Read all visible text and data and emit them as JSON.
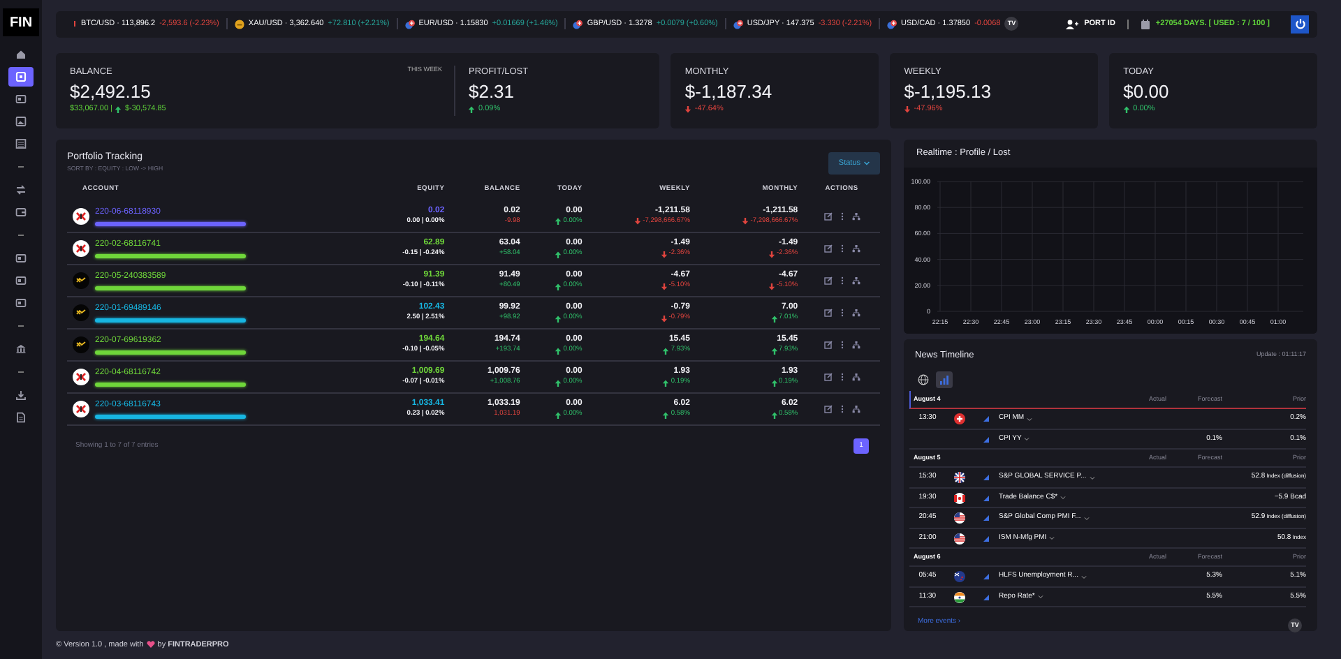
{
  "brand": {
    "logo": "FIN"
  },
  "sidebar": {
    "groups": [
      {
        "items": [
          {
            "kind": "home",
            "selected": false
          },
          {
            "kind": "square",
            "selected": true
          },
          {
            "kind": "card",
            "selected": false
          },
          {
            "kind": "image",
            "selected": false
          },
          {
            "kind": "list",
            "selected": false
          }
        ]
      },
      {
        "items": [
          {
            "kind": "exchange",
            "selected": false
          },
          {
            "kind": "wallet",
            "selected": false
          }
        ]
      },
      {
        "items": [
          {
            "kind": "card",
            "selected": false
          },
          {
            "kind": "card",
            "selected": false
          },
          {
            "kind": "card",
            "selected": false
          }
        ]
      },
      {
        "items": [
          {
            "kind": "bank",
            "selected": false
          }
        ]
      },
      {
        "items": [
          {
            "kind": "download",
            "selected": false
          },
          {
            "kind": "file",
            "selected": false
          }
        ]
      }
    ]
  },
  "ticker": {
    "items": [
      {
        "kind": "cut",
        "label": "BTC/USD · 113,896.2",
        "change": "-2,593.6 (-2.23%)",
        "rising": false
      },
      {
        "kind": "gold",
        "label": "XAU/USD · 3,362.640",
        "change": "+72.810 (+2.21%)",
        "rising": true
      },
      {
        "kind": "flags",
        "label": "EUR/USD · 1.15830",
        "change": "+0.01669 (+1.46%)",
        "rising": true
      },
      {
        "kind": "flags",
        "label": "GBP/USD · 1.3278",
        "change": "+0.0079 (+0.60%)",
        "rising": true
      },
      {
        "kind": "flags",
        "label": "USD/JPY · 147.375",
        "change": "-3.330 (-2.21%)",
        "rising": false
      },
      {
        "kind": "flags",
        "label": "USD/CAD · 1.37850",
        "change": "-0.0068",
        "rising": false
      }
    ],
    "badge": "TV"
  },
  "account": {
    "port_id": "PORT ID",
    "subscription": "+27054 DAYS. [ USED : 7 / 100 ]"
  },
  "balance_card": {
    "sections": [
      {
        "label": "BALANCE",
        "period": "THIS WEEK",
        "value": "$2,492.15",
        "base": "$33,067.00 |",
        "change": "$-30,574.85",
        "rising": true
      },
      {
        "label": "PROFIT/LOST",
        "value": "$2.31",
        "change": "0.09%",
        "rising": true
      }
    ]
  },
  "stat_cards": [
    {
      "label": "MONTHLY",
      "value": "$-1,187.34",
      "change": "-47.64%",
      "rising": false
    },
    {
      "label": "WEEKLY",
      "value": "$-1,195.13",
      "change": "-47.96%",
      "rising": false
    },
    {
      "label": "TODAY",
      "value": "$0.00",
      "change": "0.00%",
      "rising": true
    }
  ],
  "portfolio": {
    "title": "Portfolio Tracking",
    "subtitle": "SORT BY : EQUITY : LOW -> HIGH",
    "status_button": "Status",
    "columns": [
      "ACCOUNT",
      "EQUITY",
      "BALANCE",
      "TODAY",
      "WEEKLY",
      "MONTHLY",
      "ACTIONS"
    ],
    "rows": [
      {
        "kind": "xm",
        "account": "220-06-68118930",
        "color": "#6c63ff",
        "equity": "0.02",
        "equity_change": "0.00 | 0.00%",
        "balance": "0.02",
        "balance_change": "-9.98",
        "balance_up": false,
        "today": "0.00",
        "today_change": "0.00%",
        "today_up": true,
        "weekly": "-1,211.58",
        "weekly_change": "-7,298,666.67%",
        "weekly_up": false,
        "monthly": "-1,211.58",
        "monthly_change": "-7,298,666.67%",
        "monthly_up": false
      },
      {
        "kind": "xm",
        "account": "220-02-68116741",
        "color": "#6fd63a",
        "equity": "62.89",
        "equity_change": "-0.15 | -0.24%",
        "balance": "63.04",
        "balance_change": "+58.04",
        "balance_up": true,
        "today": "0.00",
        "today_change": "0.00%",
        "today_up": true,
        "weekly": "-1.49",
        "weekly_change": "-2.36%",
        "weekly_up": false,
        "monthly": "-1.49",
        "monthly_change": "-2.36%",
        "monthly_up": false
      },
      {
        "kind": "exness",
        "account": "220-05-240383589",
        "color": "#6fd63a",
        "equity": "91.39",
        "equity_change": "-0.10 | -0.11%",
        "balance": "91.49",
        "balance_change": "+80.49",
        "balance_up": true,
        "today": "0.00",
        "today_change": "0.00%",
        "today_up": true,
        "weekly": "-4.67",
        "weekly_change": "-5.10%",
        "weekly_up": false,
        "monthly": "-4.67",
        "monthly_change": "-5.10%",
        "monthly_up": false
      },
      {
        "kind": "exness",
        "account": "220-01-69489146",
        "color": "#17b6e2",
        "equity": "102.43",
        "equity_change": "2.50 | 2.51%",
        "balance": "99.92",
        "balance_change": "+98.92",
        "balance_up": true,
        "today": "0.00",
        "today_change": "0.00%",
        "today_up": true,
        "weekly": "-0.79",
        "weekly_change": "-0.79%",
        "weekly_up": false,
        "monthly": "7.00",
        "monthly_change": "7.01%",
        "monthly_up": true
      },
      {
        "kind": "exness",
        "account": "220-07-69619362",
        "color": "#6fd63a",
        "equity": "194.64",
        "equity_change": "-0.10 | -0.05%",
        "balance": "194.74",
        "balance_change": "+193.74",
        "balance_up": true,
        "today": "0.00",
        "today_change": "0.00%",
        "today_up": true,
        "weekly": "15.45",
        "weekly_change": "7.93%",
        "weekly_up": true,
        "monthly": "15.45",
        "monthly_change": "7.93%",
        "monthly_up": true
      },
      {
        "kind": "xm",
        "account": "220-04-68116742",
        "color": "#6fd63a",
        "equity": "1,009.69",
        "equity_change": "-0.07 | -0.01%",
        "balance": "1,009.76",
        "balance_change": "+1,008.76",
        "balance_up": true,
        "today": "0.00",
        "today_change": "0.00%",
        "today_up": true,
        "weekly": "1.93",
        "weekly_change": "0.19%",
        "weekly_up": true,
        "monthly": "1.93",
        "monthly_change": "0.19%",
        "monthly_up": true
      },
      {
        "kind": "xm",
        "account": "220-03-68116743",
        "color": "#17b6e2",
        "equity": "1,033.41",
        "equity_change": "0.23 | 0.02%",
        "balance": "1,033.19",
        "balance_change": "1,031.19",
        "balance_up": false,
        "today": "0.00",
        "today_change": "0.00%",
        "today_up": true,
        "weekly": "6.02",
        "weekly_change": "0.58%",
        "weekly_up": true,
        "monthly": "6.02",
        "monthly_change": "0.58%",
        "monthly_up": true
      }
    ],
    "info": "Showing 1 to 7 of 7 entries",
    "pages": [
      {
        "label": "1",
        "selected": true
      }
    ]
  },
  "realtime": {
    "title": "Realtime : Profile / Lost",
    "chart_data": {
      "type": "line",
      "grid": true,
      "categories": [
        "22:15",
        "22:30",
        "22:45",
        "23:00",
        "23:15",
        "23:30",
        "23:45",
        "00:00",
        "00:15",
        "00:30",
        "00:45",
        "01:00"
      ],
      "ylim": [
        0,
        100
      ],
      "yticks": [
        {
          "value": 0,
          "label": "0"
        },
        {
          "value": 20,
          "label": "20.00"
        },
        {
          "value": 40,
          "label": "40.00"
        },
        {
          "value": 60,
          "label": "60.00"
        },
        {
          "value": 80,
          "label": "80.00"
        },
        {
          "value": 100,
          "label": "100.00"
        }
      ]
    }
  },
  "news": {
    "title": "News Timeline",
    "update": "Update : 01:11:17",
    "filters": [
      {
        "kind": "globe",
        "selected": false
      },
      {
        "kind": "bars",
        "selected": true
      }
    ],
    "days": [
      {
        "date": "August 4",
        "current": true,
        "columns": [
          "Actual",
          "Forecast",
          "Prior"
        ],
        "events": [
          {
            "time": "13:30",
            "kind": "ch",
            "name": "CPI MM",
            "prior": "0.2%"
          },
          {
            "name": "CPI YY",
            "forecast": "0.1%",
            "prior": "0.1%"
          }
        ]
      },
      {
        "date": "August 5",
        "current": false,
        "columns": [
          "Actual",
          "Forecast",
          "Prior"
        ],
        "events": [
          {
            "time": "15:30",
            "kind": "gb",
            "name": "S&P GLOBAL SERVICE P...",
            "prior": "52.8",
            "prior_unit": "Index (diffusion)"
          },
          {
            "time": "19:30",
            "kind": "ca",
            "name": "Trade Balance C$*",
            "prior": "−5.9 Bcad"
          },
          {
            "time": "20:45",
            "kind": "us",
            "name": "S&P Global Comp PMI F...",
            "prior": "52.9",
            "prior_unit": "Index (diffusion)"
          },
          {
            "time": "21:00",
            "kind": "us",
            "name": "ISM N-Mfg PMI",
            "prior": "50.8",
            "prior_unit": "Index"
          }
        ]
      },
      {
        "date": "August 6",
        "current": false,
        "columns": [
          "Actual",
          "Forecast",
          "Prior"
        ],
        "events": [
          {
            "time": "05:45",
            "kind": "nz",
            "name": "HLFS Unemployment R...",
            "forecast": "5.3%",
            "prior": "5.1%"
          },
          {
            "time": "11:30",
            "kind": "in",
            "name": "Repo Rate*",
            "forecast": "5.5%",
            "prior": "5.5%"
          }
        ]
      }
    ],
    "more": "More events ›",
    "badge": "TV"
  },
  "footer": {
    "text": "© Version 1.0 , made with",
    "author": "by **FINTRADERPRO**"
  }
}
